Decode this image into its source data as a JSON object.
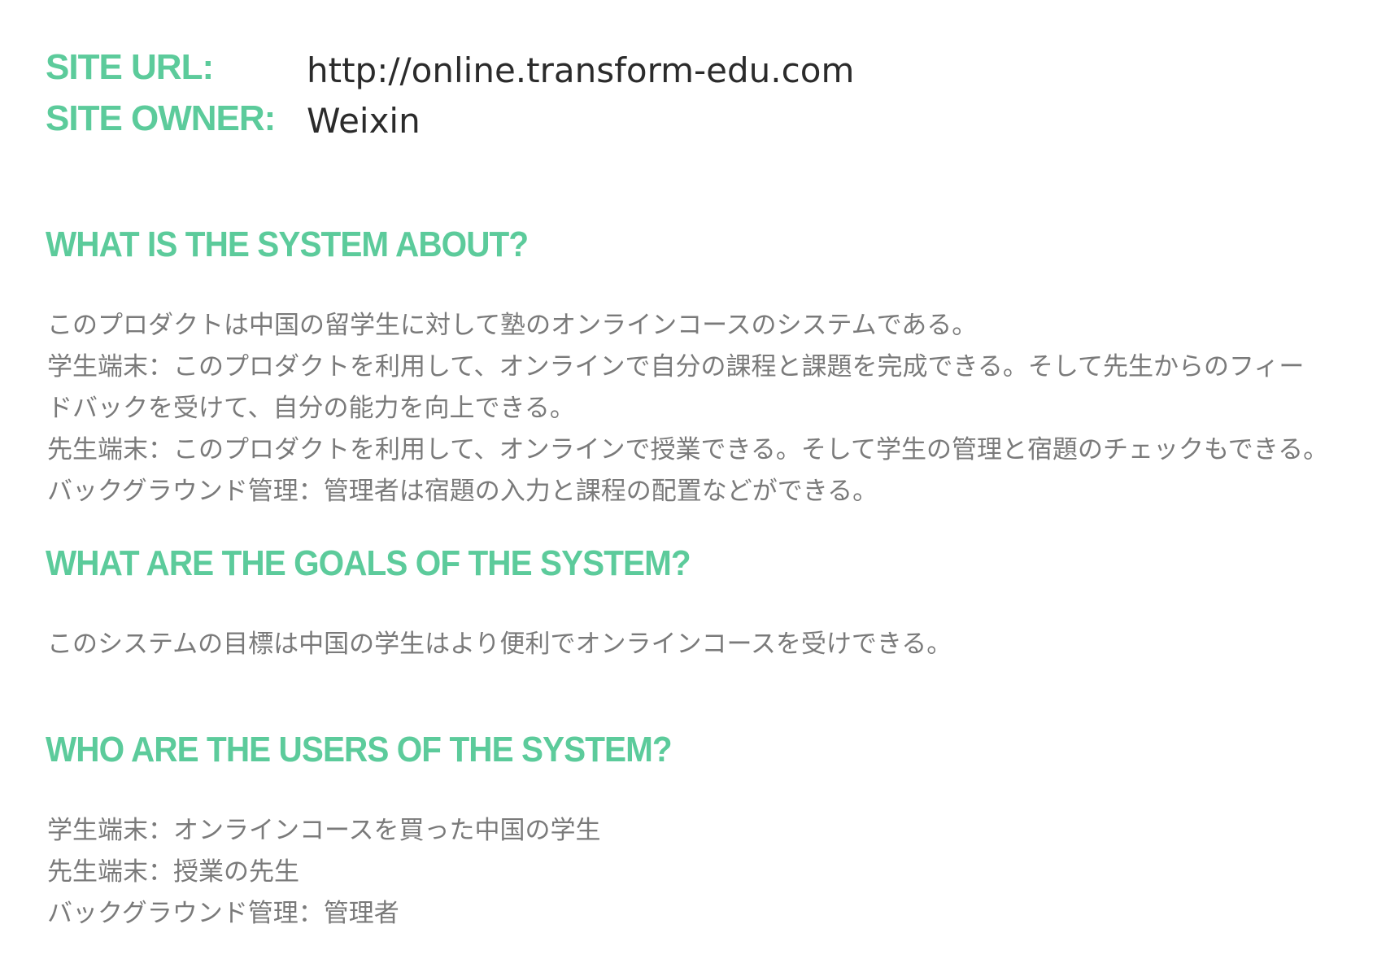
{
  "site": {
    "url_label": "SITE URL:",
    "url_value": "http://online.transform-edu.com",
    "owner_label": "SITE OWNER:",
    "owner_value": "Weixin"
  },
  "sections": [
    {
      "heading": "WHAT IS THE SYSTEM ABOUT?",
      "lines": [
        "このプロダクトは中国の留学生に対して塾のオンラインコースのシステムである。",
        "学生端末：このプロダクトを利用して、オンラインで自分の課程と課題を完成できる。そして先生からのフィー",
        "ドバックを受けて、自分の能力を向上できる。",
        "先生端末：このプロダクトを利用して、オンラインで授業できる。そして学生の管理と宿題のチェックもできる。",
        "バックグラウンド管理：管理者は宿題の入力と課程の配置などができる。"
      ]
    },
    {
      "heading": "WHAT ARE THE GOALS OF THE SYSTEM?",
      "lines": [
        "このシステムの目標は中国の学生はより便利でオンラインコースを受けできる。"
      ]
    },
    {
      "heading": "WHO ARE THE USERS OF THE SYSTEM?",
      "lines": [
        "学生端末：オンラインコースを買った中国の学生",
        "先生端末：授業の先生",
        "バックグラウンド管理：管理者"
      ]
    }
  ]
}
